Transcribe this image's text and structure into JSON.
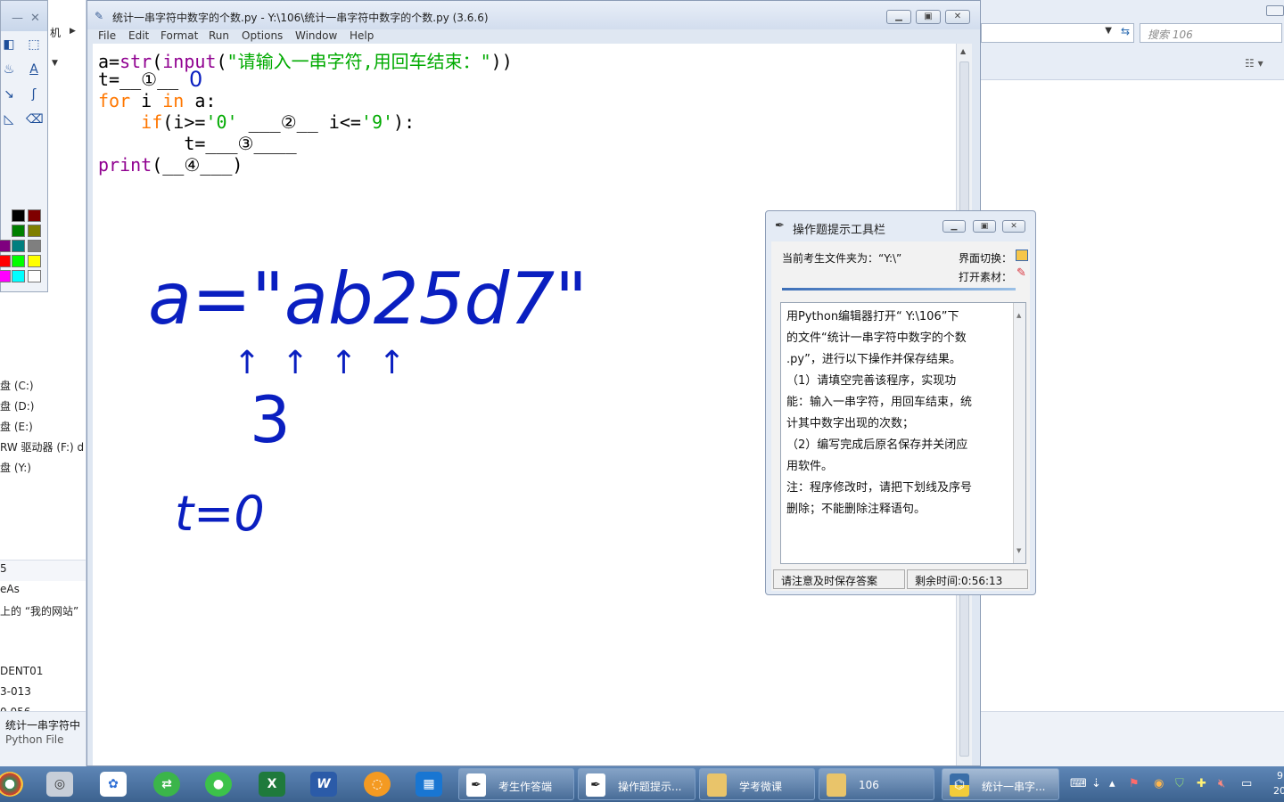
{
  "left_window": {
    "title_fragment": "机",
    "drives": [
      "盘 (C:)",
      "盘 (D:)",
      "盘 (E:)",
      "RW 驱动器 (F:) d",
      "盘 (Y:)"
    ],
    "lower_items": [
      "5",
      "eAs",
      "上的 “我的网站”",
      "DENT01",
      "3-013",
      "0 056"
    ],
    "selected_file_name": "统计一串字符中",
    "selected_file_type": "Python File"
  },
  "right_window": {
    "search_placeholder": "搜索 106"
  },
  "idle": {
    "title": "统计一串字符中数字的个数.py - Y:\\106\\统计一串字符中数字的个数.py (3.6.6)",
    "menu": [
      "File",
      "Edit",
      "Format",
      "Run",
      "Options",
      "Window",
      "Help"
    ],
    "code": {
      "line1_var": "a=",
      "line1_str": "str",
      "line1_paren": "(",
      "line1_input": "input",
      "line1_open": "(",
      "line1_prompt": "\"请输入一串字符,用回车结束：\"",
      "line1_close": "))",
      "line2": "t=__①__",
      "line3_for": "for",
      "line3_i": " i ",
      "line3_in": "in",
      "line3_rest": " a:",
      "line4_indent": "    ",
      "line4_if": "if",
      "line4_cond": "(i>=",
      "line4_zero": "'0'",
      "line4_mid": " ___②__ i<=",
      "line4_nine": "'9'",
      "line4_end": "):",
      "line5": "        t=___③____",
      "line6_print": "print",
      "line6_rest": "(__④___)"
    },
    "handwriting": {
      "line2_answer": "0",
      "example_string": "a=\"ab25d7\"",
      "example_count": "3",
      "init_note": "t=0"
    }
  },
  "hint_dialog": {
    "title": "操作题提示工具栏",
    "folder_label": "当前考生文件夹为：“Y:\\”",
    "switch_label": "界面切换：",
    "open_label": "打开素材：",
    "instructions": [
      "用Python编辑器打开“ Y:\\106”下",
      "的文件“统计一串字符中数字的个数",
      ".py”，进行以下操作并保存结果。",
      "（1）请填空完善该程序，实现功",
      "能：输入一串字符，用回车结束，统",
      "计其中数字出现的次数；",
      "（2）编写完成后原名保存并关闭应",
      "用软件。",
      "注：程序修改时，请把下划线及序号",
      "删除；不能删除注释语句。"
    ],
    "status_save": "请注意及时保存答案",
    "status_time": "剩余时间:0:56:13"
  },
  "taskbar": {
    "tasks": [
      "考生作答端",
      "操作题提示...",
      "学考微课",
      "106",
      "统计一串字..."
    ],
    "clock_top": "9",
    "clock_bottom": "20"
  }
}
